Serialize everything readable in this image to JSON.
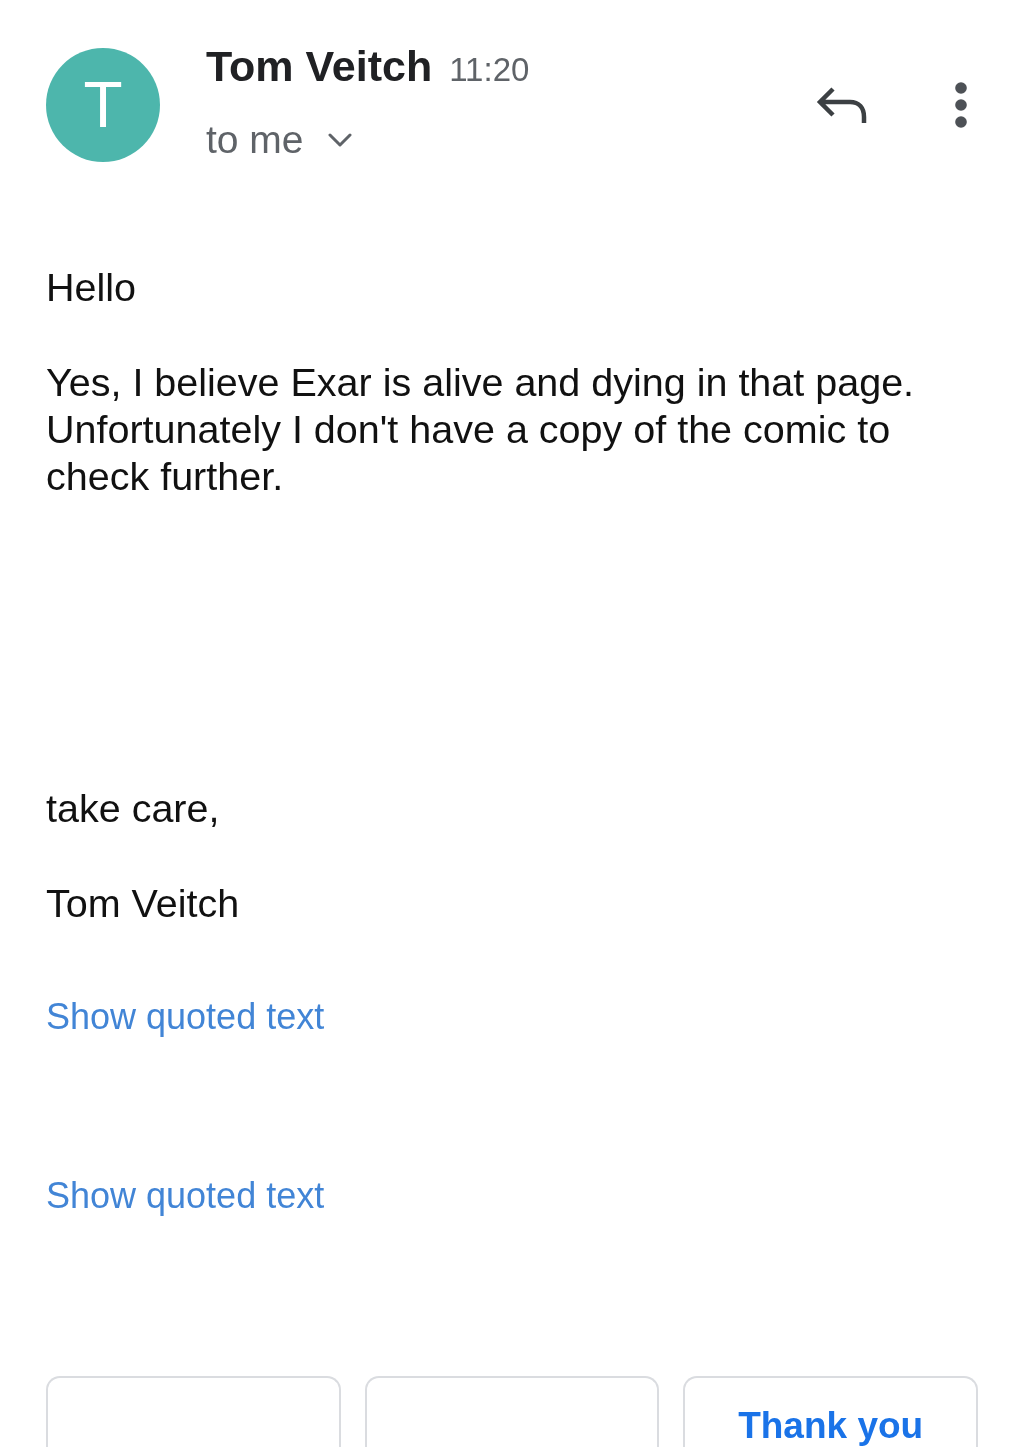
{
  "header": {
    "avatar_initial": "T",
    "sender": "Tom Veitch",
    "time": "11:20",
    "recipient": "to me"
  },
  "body": {
    "paragraphs": [
      "Hello",
      "Yes, I believe Exar is alive and dying in that page. Unfortunately I don't have a copy of the comic to check further."
    ],
    "closing": [
      "take care,",
      "Tom Veitch"
    ]
  },
  "quoted_text_links": [
    "Show quoted text",
    "Show quoted text"
  ],
  "smart_replies": [
    {
      "kind": "cut"
    },
    {
      "kind": "cut"
    },
    {
      "kind": "text",
      "label": "Thank you"
    }
  ]
}
